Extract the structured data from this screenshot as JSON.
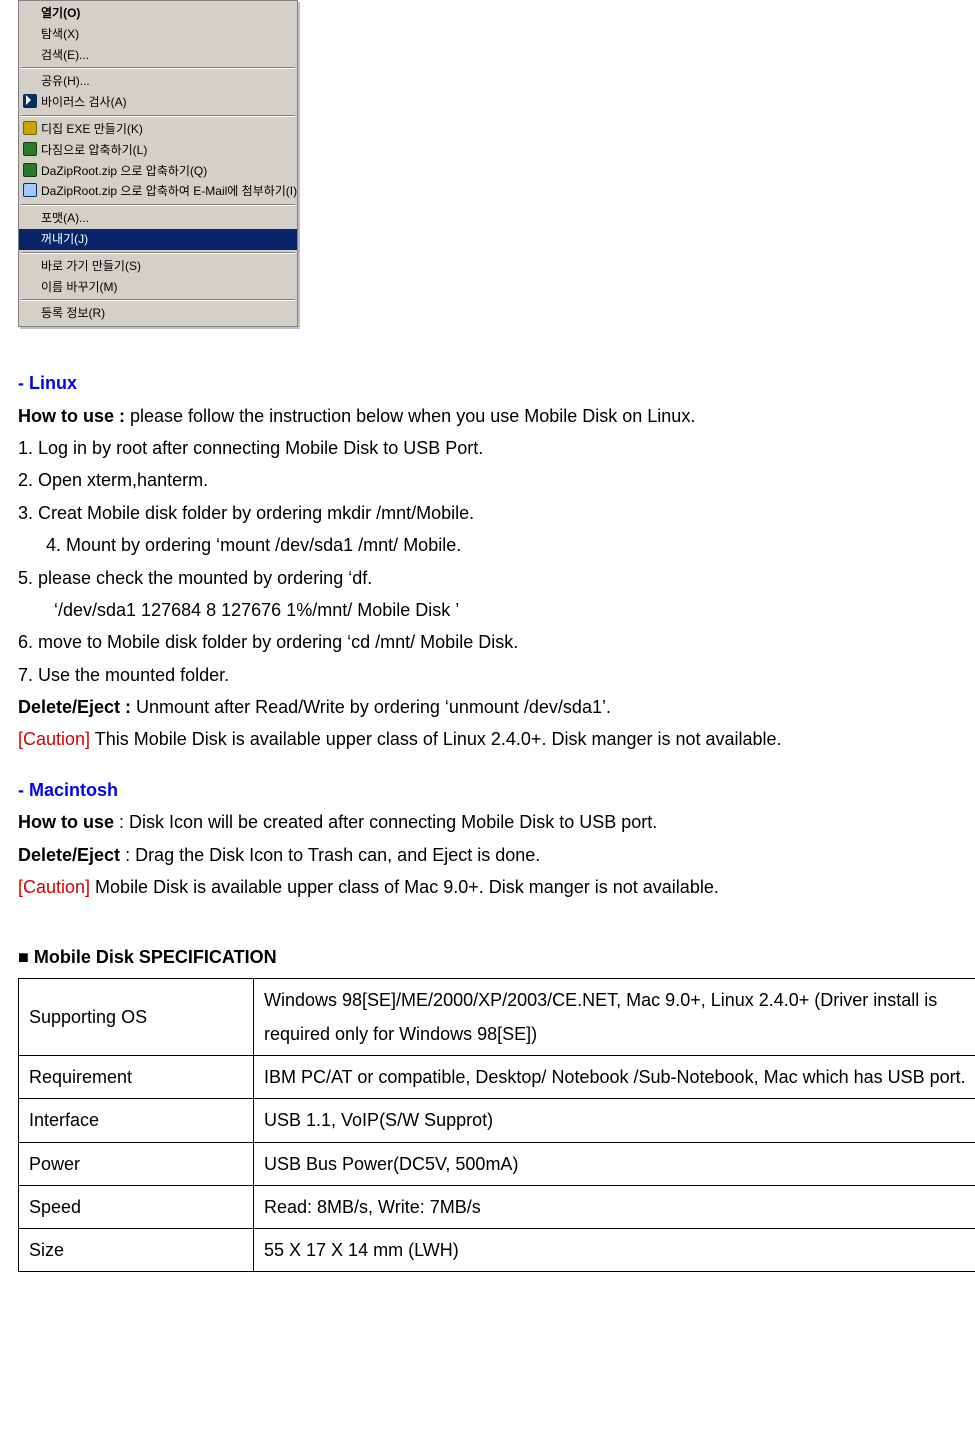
{
  "context_menu": {
    "items_group1": [
      {
        "label": "열기(O)",
        "bold": true
      },
      {
        "label": "탐색(X)"
      },
      {
        "label": "검색(E)..."
      }
    ],
    "items_group2": [
      {
        "label": "공유(H)...",
        "icon": ""
      },
      {
        "label": "바이러스 검사(A)",
        "icon": "av"
      }
    ],
    "items_group3": [
      {
        "label": "디집 EXE 만들기(K)",
        "icon": "db"
      },
      {
        "label": "다짐으로 압축하기(L)",
        "icon": "dz"
      },
      {
        "label": "DaZipRoot.zip 으로 압축하기(Q)",
        "icon": "dz"
      },
      {
        "label": "DaZipRoot.zip 으로 압축하여 E-Mail에 첨부하기(I)",
        "icon": "dm"
      }
    ],
    "items_group4": [
      {
        "label": "포맷(A)..."
      },
      {
        "label": "꺼내기(J)",
        "selected": true
      }
    ],
    "items_group5": [
      {
        "label": "바로 가기 만들기(S)"
      },
      {
        "label": "이름 바꾸기(M)"
      }
    ],
    "items_group6": [
      {
        "label": "등록 정보(R)"
      }
    ]
  },
  "linux": {
    "header": "- Linux",
    "howto_label": "How to use :",
    "howto_text": " please follow the instruction below when you use Mobile Disk on Linux.",
    "steps": {
      "s1": "1. Log in by root after connecting Mobile Disk to USB Port.",
      "s2": "2. Open xterm,hanterm.",
      "s3": "3. Creat Mobile disk folder by ordering mkdir /mnt/Mobile.",
      "s4": "4. Mount by ordering ‘mount /dev/sda1 /mnt/ Mobile.",
      "s5": "5. please check the mounted by ordering ‘df.",
      "s5b": "‘/dev/sda1 127684 8 127676 1%/mnt/ Mobile Disk ’",
      "s6": "6. move to Mobile disk folder by ordering ‘cd /mnt/ Mobile Disk.",
      "s7": "7. Use the mounted folder."
    },
    "eject_label": "Delete/Eject :",
    "eject_text": " Unmount after Read/Write by ordering ‘unmount /dev/sda1’.",
    "caution_label": "[Caution]",
    "caution_text": " This Mobile Disk is available upper class of Linux 2.4.0+. Disk manger is not available."
  },
  "mac": {
    "header": "- Macintosh",
    "howto_label": "How to use",
    "howto_text": " : Disk Icon will be created after connecting Mobile Disk to USB port.",
    "eject_label": "Delete/Eject",
    "eject_text": " : Drag the Disk Icon to Trash can, and Eject is done.",
    "caution_label": "[Caution]",
    "caution_text": " Mobile Disk is available upper class of  Mac 9.0+. Disk manger is not available."
  },
  "spec": {
    "title": "■ Mobile Disk SPECIFICATION",
    "rows": {
      "os_label": "Supporting OS",
      "os_value": "Windows 98[SE]/ME/2000/XP/2003/CE.NET, Mac 9.0+, Linux 2.4.0+ (Driver install is required only for Windows 98[SE])",
      "req_label": "Requirement",
      "req_value": "IBM PC/AT or compatible, Desktop/ Notebook /Sub-Notebook, Mac which has USB port.",
      "if_label": "Interface",
      "if_value": "USB 1.1, VoIP(S/W Supprot)",
      "pw_label": "Power",
      "pw_value": "USB Bus Power(DC5V, 500mA)",
      "sp_label": "Speed",
      "sp_value": "Read: 8MB/s,   Write: 7MB/s",
      "sz_label": "Size",
      "sz_value": "55 X 17 X 14 mm (LWH)"
    }
  }
}
